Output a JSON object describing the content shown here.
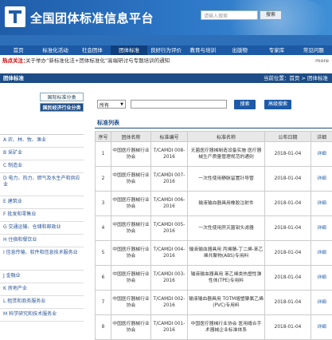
{
  "header": {
    "site_title": "全国团体标准信息平台",
    "search_placeholder": "请输入搜索",
    "search_button": "搜索"
  },
  "nav": [
    "首页",
    "标准化活动",
    "社会团体",
    "团体标准",
    "良好行为评价",
    "教育与培训",
    "出版物",
    "专家库",
    "常见问题"
  ],
  "hot": {
    "label": "热点关注：",
    "text": "关于举办“新标准化法+团体标准化”高端研讨与专题培训的通知",
    "more": "more"
  },
  "section": {
    "title": "团体标准",
    "breadcrumb": "当前位置：首页 > 团体标准"
  },
  "sidebar": {
    "tabs": [
      "国际标准分类",
      "国民经济行业分类"
    ],
    "categories": [
      "A 农、林、牧、渔业",
      "B 采矿业",
      "C 制造业",
      "D 电力、热力、燃气及水生产和供应业",
      "E 建筑业",
      "F 批发和零售业",
      "G 交通运输、仓储和邮政业",
      "H 住宿和餐饮业",
      "I 信息传输、软件和信息技术服务业",
      "J 金融业",
      "K 房地产业",
      "L 租赁和商务服务业",
      "M 科学研究和技术服务业"
    ]
  },
  "filter": {
    "select_value": "所有",
    "keyword_value": "",
    "search_button": "搜索",
    "advanced_button": "高级搜索"
  },
  "list": {
    "title": "标准列表",
    "columns": [
      "序号",
      "团体名称",
      "标准编号",
      "标准名称",
      "公布日期",
      "详细"
    ],
    "rows": [
      {
        "no": "1",
        "org": "中国医疗器械行业协会",
        "code": "T/CAMDI 008-2016",
        "name": "无菌医疗器械制造设备实施 医疗器械生产质量管理规范的通则",
        "date": "2018-01-04",
        "detail": "详细"
      },
      {
        "no": "2",
        "org": "中国医疗器械行业协会",
        "code": "T/CAMDI 007-2016",
        "name": "一次性使用静脉留置针导管",
        "date": "2018-01-04",
        "detail": "详细"
      },
      {
        "no": "3",
        "org": "中国医疗器械行业协会",
        "code": "T/CAMDI 006-2016",
        "name": "输液输血器具用橡胶注射件",
        "date": "2018-01-04",
        "detail": "详细"
      },
      {
        "no": "4",
        "org": "中国医疗器械行业协会",
        "code": "T/CAMDI 005-2016",
        "name": "一次性使用肝灭菌钳头滤器",
        "date": "2018-01-04",
        "detail": "详细"
      },
      {
        "no": "5",
        "org": "中国医疗器械行业协会",
        "code": "T/CAMDI 004-2016",
        "name": "输液输血器具用 丙烯腈-丁二烯-苯乙烯共聚物(ABS)专用料",
        "date": "2018-01-04",
        "detail": "详细"
      },
      {
        "no": "6",
        "org": "中国医疗器械行业协会",
        "code": "T/CAMDI 003-2016",
        "name": "输液输血器具用 苯乙烯类热塑性弹性体(TPE)专用料",
        "date": "2018-01-04",
        "detail": "详细"
      },
      {
        "no": "7",
        "org": "中国医疗器械行业协会",
        "code": "T/CAMDI 002-2016",
        "name": "输液输血器具用 TOTM增塑聚氯乙烯(PVC)专用料",
        "date": "2018-01-04",
        "detail": "详细"
      },
      {
        "no": "8",
        "org": "中国医疗器械行业协会",
        "code": "T/CAMDI 001-2016",
        "name": "中国医疗器械行业协会 医用缝合手术器械企业标准体系",
        "date": "2018-01-04",
        "detail": "详细"
      }
    ]
  }
}
